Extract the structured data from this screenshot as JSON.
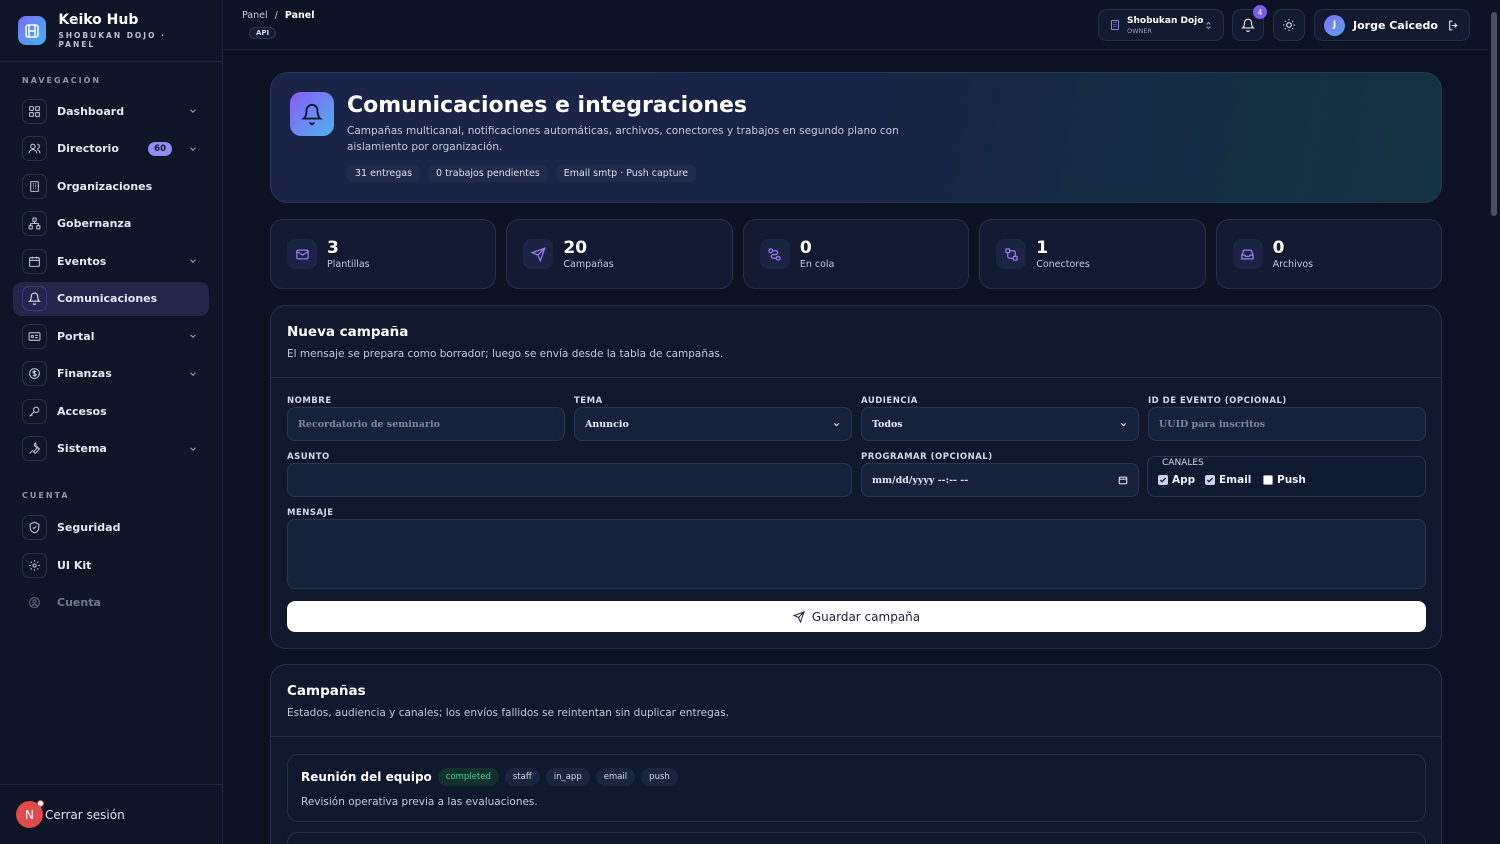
{
  "brand": {
    "title": "Keiko Hub",
    "subtitle": "SHOBUKAN DOJO · PANEL"
  },
  "sidebar": {
    "nav_label": "NAVEGACIÓN",
    "account_label": "CUENTA",
    "items": [
      {
        "label": "Dashboard",
        "icon": "grid-icon",
        "chevron": true
      },
      {
        "label": "Directorio",
        "icon": "users-icon",
        "badge": "60",
        "chevron": true
      },
      {
        "label": "Organizaciones",
        "icon": "building-icon"
      },
      {
        "label": "Gobernanza",
        "icon": "network-icon"
      },
      {
        "label": "Eventos",
        "icon": "calendar-icon",
        "chevron": true
      },
      {
        "label": "Comunicaciones",
        "icon": "bell-icon",
        "active": true
      },
      {
        "label": "Portal",
        "icon": "id-card-icon",
        "chevron": true
      },
      {
        "label": "Finanzas",
        "icon": "dollar-icon",
        "chevron": true
      },
      {
        "label": "Accesos",
        "icon": "key-icon"
      },
      {
        "label": "Sistema",
        "icon": "wrench-icon",
        "chevron": true
      }
    ],
    "account_items": [
      {
        "label": "Seguridad",
        "icon": "shield-icon"
      },
      {
        "label": "UI Kit",
        "icon": "gear-icon"
      },
      {
        "label": "Cuenta",
        "icon": "user-circle-icon",
        "muted": true
      }
    ],
    "logout": {
      "avatar": "N",
      "label": "Cerrar sesión"
    }
  },
  "topbar": {
    "breadcrumb_root": "Panel",
    "breadcrumb_sep": "/",
    "breadcrumb_current": "Panel",
    "api_tag": "API",
    "org_name": "Shobukan Dojo",
    "org_role": "OWNER",
    "notifications": "4",
    "user_initial": "J",
    "user_name": "Jorge Caicedo"
  },
  "hero": {
    "title": "Comunicaciones e integraciones",
    "description": "Campañas multicanal, notificaciones automáticas, archivos, conectores y trabajos en segundo plano con aislamiento por organización.",
    "chips": [
      "31 entregas",
      "0 trabajos pendientes",
      "Email smtp · Push capture"
    ]
  },
  "stats": [
    {
      "value": "3",
      "label": "Plantillas",
      "icon": "mail-icon"
    },
    {
      "value": "20",
      "label": "Campañas",
      "icon": "send-icon"
    },
    {
      "value": "0",
      "label": "En cola",
      "icon": "route-icon"
    },
    {
      "value": "1",
      "label": "Conectores",
      "icon": "workflow-icon"
    },
    {
      "value": "0",
      "label": "Archivos",
      "icon": "inbox-icon"
    }
  ],
  "form": {
    "title": "Nueva campaña",
    "subtitle": "El mensaje se prepara como borrador; luego se envía desde la tabla de campañas.",
    "name_label": "NOMBRE",
    "name_placeholder": "Recordatorio de seminario",
    "topic_label": "TEMA",
    "topic_value": "Anuncio",
    "audience_label": "AUDIENCIA",
    "audience_value": "Todos",
    "event_label": "ID DE EVENTO (OPCIONAL)",
    "event_placeholder": "UUID para inscritos",
    "subject_label": "ASUNTO",
    "subject_value": "",
    "schedule_label": "PROGRAMAR (OPCIONAL)",
    "schedule_placeholder": "mm/dd/yyyy --:-- --",
    "channels_label": "CANALES",
    "channels": [
      {
        "label": "App",
        "checked": true
      },
      {
        "label": "Email",
        "checked": true
      },
      {
        "label": "Push",
        "checked": false
      }
    ],
    "message_label": "MENSAJE",
    "message_value": "",
    "save_label": "Guardar campaña"
  },
  "campaigns": {
    "title": "Campañas",
    "subtitle": "Estados, audiencia y canales; los envíos fallidos se reintentan sin duplicar entregas.",
    "rows": [
      {
        "title": "Reunión del equipo",
        "status": "completed",
        "tags": [
          "staff",
          "in_app",
          "email",
          "push"
        ],
        "description": "Revisión operativa previa a las evaluaciones."
      }
    ]
  },
  "colors": {
    "accent": "#8b8ff0",
    "background": "#0b1222",
    "success": "#3ed598",
    "notification": "#7c5cf0"
  }
}
